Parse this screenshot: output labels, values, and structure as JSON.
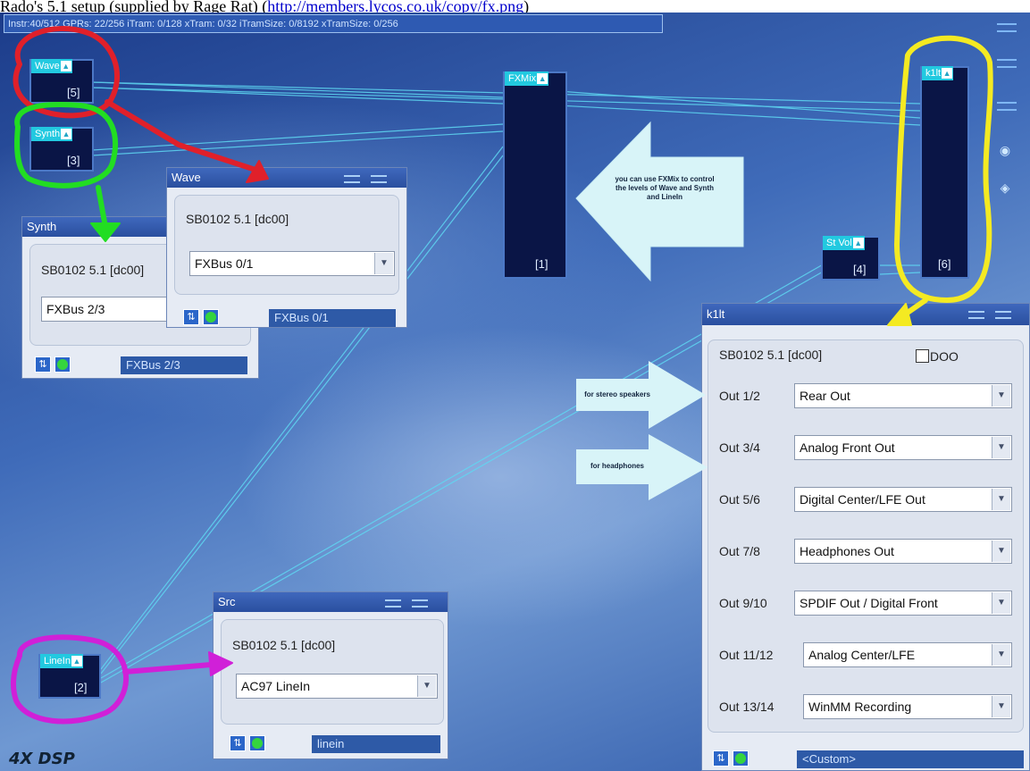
{
  "caption": {
    "text": "Rado's 5.1 setup (supplied by Rage Rat) (",
    "link": "http://members.lycos.co.uk/copy/fx.png",
    "tail": ")"
  },
  "status": "Instr:40/512 GPRs: 22/256 iTram: 0/128 xTram: 0/32 iTramSize: 0/8192 xTramSize: 0/256",
  "blocks": {
    "wave": {
      "title": "Wave",
      "num": "[5]"
    },
    "synth": {
      "title": "Synth",
      "num": "[3]"
    },
    "fxmix": {
      "title": "FXMix",
      "num": "[1]"
    },
    "k1lt": {
      "title": "k1lt",
      "num": "[6]"
    },
    "stvol": {
      "title": "St Vol",
      "num": "[4]"
    },
    "linein": {
      "title": "LineIn",
      "num": "[2]"
    }
  },
  "windows": {
    "synth": {
      "title": "Synth",
      "device": "SB0102 5.1 [dc00]",
      "select": "FXBus 2/3",
      "bus": "FXBus 2/3"
    },
    "wave": {
      "title": "Wave",
      "device": "SB0102 5.1 [dc00]",
      "select": "FXBus 0/1",
      "bus": "FXBus 0/1"
    },
    "src": {
      "title": "Src",
      "device": "SB0102 5.1 [dc00]",
      "select": "AC97 LineIn",
      "bus": "linein"
    },
    "k1lt": {
      "title": "k1lt",
      "device": "SB0102 5.1 [dc00]",
      "checkbox_label": "DOO",
      "outputs": [
        {
          "label": "Out 1/2",
          "value": "Rear Out"
        },
        {
          "label": "Out 3/4",
          "value": "Analog Front Out"
        },
        {
          "label": "Out 5/6",
          "value": "Digital Center/LFE Out"
        },
        {
          "label": "Out 7/8",
          "value": "Headphones Out"
        },
        {
          "label": "Out 9/10",
          "value": "SPDIF Out / Digital Front"
        },
        {
          "label": "Out 11/12",
          "value": "Analog Center/LFE"
        },
        {
          "label": "Out 13/14",
          "value": "WinMM Recording"
        }
      ],
      "bus": "<Custom>"
    }
  },
  "annotations": {
    "fxmix_note": "you can use FXMix to control the levels of Wave and Synth and LineIn",
    "stereo_note": "for stereo speakers",
    "headphones_note": "for headphones"
  },
  "brand": "4X DSP",
  "colors": {
    "red": "#e0202a",
    "green": "#22dd22",
    "yellow": "#f4ea22",
    "magenta": "#d020d8",
    "wire": "#5fd8f2"
  }
}
